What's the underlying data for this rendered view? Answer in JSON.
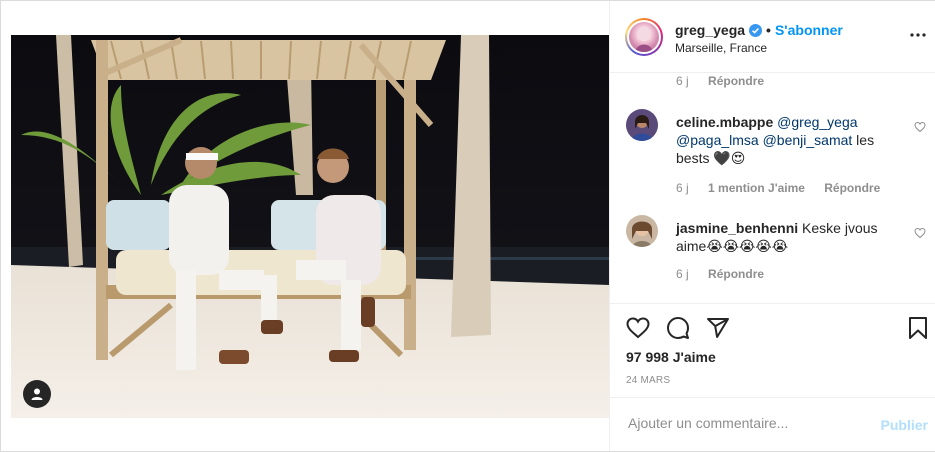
{
  "header": {
    "username": "greg_yega",
    "separator": "•",
    "follow_label": "S'abonner",
    "location": "Marseille, France",
    "more_icon": "more-horizontal-icon",
    "verified_icon": "verified-badge-icon"
  },
  "comments": [
    {
      "meta_time": "6 j",
      "meta_reply": "Répondre"
    },
    {
      "username": "celine.mbappe",
      "mention1": "@greg_yega",
      "mention2": "@paga_lmsa",
      "mention3": "@benji_samat",
      "text_after": " les bests 🖤😍",
      "meta_time": "6 j",
      "meta_likes": "1 mention J'aime",
      "meta_reply": "Répondre"
    },
    {
      "username": "jasmine_benhenni",
      "text": " Keske jvous aime😭😭😭😭😭",
      "meta_time": "6 j",
      "meta_reply": "Répondre"
    }
  ],
  "actions": {
    "like_icon": "heart-icon",
    "comment_icon": "comment-icon",
    "share_icon": "share-icon",
    "save_icon": "bookmark-icon",
    "likes": "97 998 J'aime",
    "date": "24 MARS"
  },
  "composer": {
    "placeholder": "Ajouter un commentaire...",
    "publish_label": "Publier"
  },
  "colors": {
    "accent": "#0095f6",
    "publish_disabled": "#b2dffc",
    "muted": "#8e8e8e"
  }
}
